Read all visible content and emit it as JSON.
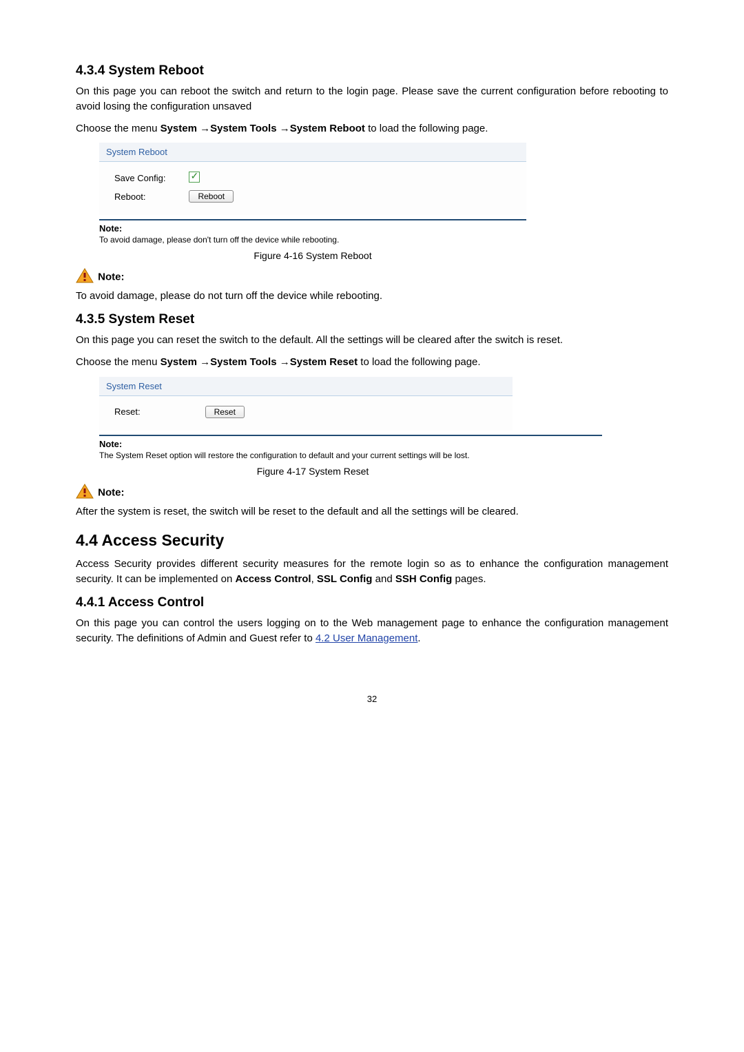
{
  "s434": {
    "heading": "4.3.4 System Reboot",
    "intro": "On this page you can reboot the switch and return to the login page. Please save the current configuration before rebooting to avoid losing the configuration unsaved",
    "menu_pre": "Choose the menu ",
    "menu_b1": "System",
    "menu_a1": " →",
    "menu_b2": "System Tools",
    "menu_a2": " →",
    "menu_b3": "System Reboot",
    "menu_post": " to load the following page.",
    "panel_title": "System Reboot",
    "save_config_label": "Save Config:",
    "reboot_label": "Reboot:",
    "reboot_btn": "Reboot",
    "note_label": "Note:",
    "note_text": "To avoid damage, please don't turn off the device while rebooting.",
    "fig_caption": "Figure 4-16 System Reboot",
    "warn_note_label": "Note:",
    "warn_note_text": "To avoid damage, please do not turn off the device while rebooting."
  },
  "s435": {
    "heading": "4.3.5 System Reset",
    "intro": "On this page you can reset the switch to the default. All the settings will be cleared after the switch is reset.",
    "menu_pre": "Choose the menu ",
    "menu_b1": "System",
    "menu_a1": " →",
    "menu_b2": "System Tools",
    "menu_a2": " →",
    "menu_b3": "System Reset",
    "menu_post": " to load the following page.",
    "panel_title": "System Reset",
    "reset_label": "Reset:",
    "reset_btn": "Reset",
    "note_label": "Note:",
    "note_text": "The System Reset option will restore the configuration to default and your current settings will be lost.",
    "fig_caption": "Figure 4-17 System Reset",
    "warn_note_label": "Note:",
    "warn_note_text": "After the system is reset, the switch will be reset to the default and all the settings will be cleared."
  },
  "s44": {
    "heading": "4.4  Access Security",
    "intro_pre": "Access Security provides different security measures for the remote login so as to enhance the configuration management security. It can be implemented on ",
    "b1": "Access Control",
    "c1": ", ",
    "b2": "SSL Config",
    "c2": " and ",
    "b3": "SSH Config",
    "intro_post": " pages."
  },
  "s441": {
    "heading": "4.4.1 Access Control",
    "intro_pre": "On this page you can control the users logging on to the Web management page to enhance the configuration management security. The definitions of Admin and Guest refer to ",
    "link": "4.2 User Management",
    "intro_post": "."
  },
  "page_number": "32"
}
